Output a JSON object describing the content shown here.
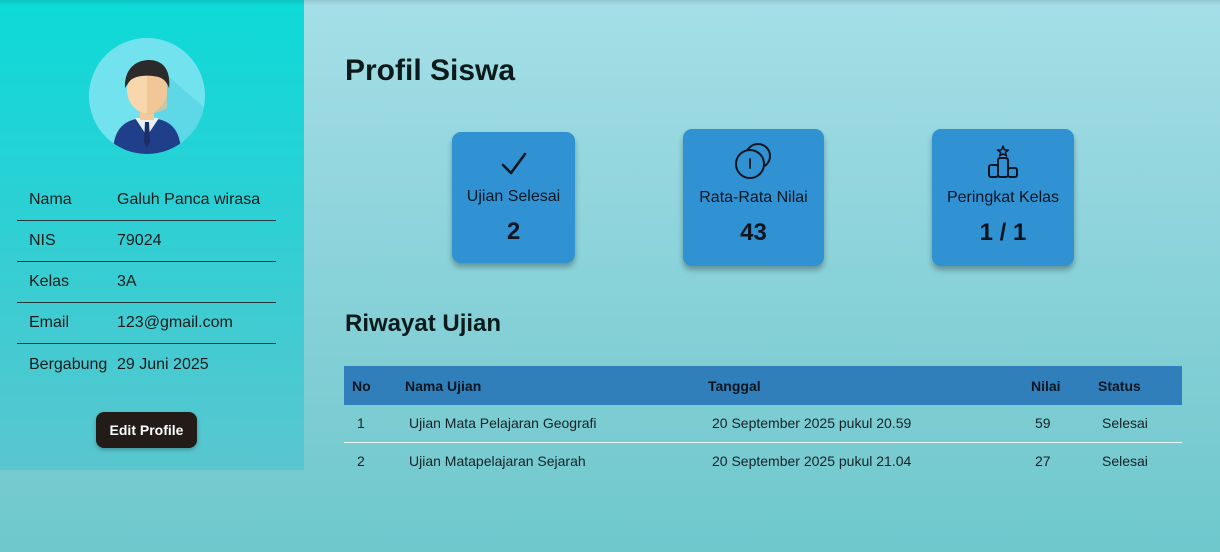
{
  "profile": {
    "avatar_icon": "student-avatar-icon",
    "fields": [
      {
        "label": "Nama",
        "value": "Galuh Panca wirasa"
      },
      {
        "label": "NIS",
        "value": "79024"
      },
      {
        "label": "Kelas",
        "value": "3A"
      },
      {
        "label": "Email",
        "value": "123@gmail.com"
      },
      {
        "label": "Bergabung",
        "value": "29 Juni 2025"
      }
    ],
    "edit_button": "Edit Profile"
  },
  "main": {
    "title": "Profil Siswa",
    "stats": [
      {
        "icon": "checkmark-icon",
        "label": "Ujian Selesai",
        "value": "2"
      },
      {
        "icon": "coins-icon",
        "label": "Rata-Rata Nilai",
        "value": "43"
      },
      {
        "icon": "podium-icon",
        "label": "Peringkat Kelas",
        "value": "1 / 1"
      }
    ],
    "history_title": "Riwayat Ujian",
    "table": {
      "headers": [
        "No",
        "Nama Ujian",
        "Tanggal",
        "Nilai",
        "Status"
      ],
      "rows": [
        [
          "1",
          "Ujian Mata Pelajaran Geografi",
          "20 September 2025 pukul 20.59",
          "59",
          "Selesai"
        ],
        [
          "2",
          "Ujian Matapelajaran Sejarah",
          "20 September 2025 pukul 21.04",
          "27",
          "Selesai"
        ]
      ]
    }
  },
  "colors": {
    "sidebar_top": "#0ddad8",
    "card_bg": "#3091d3",
    "table_header_bg": "#307fba",
    "button_bg": "#231b17"
  }
}
